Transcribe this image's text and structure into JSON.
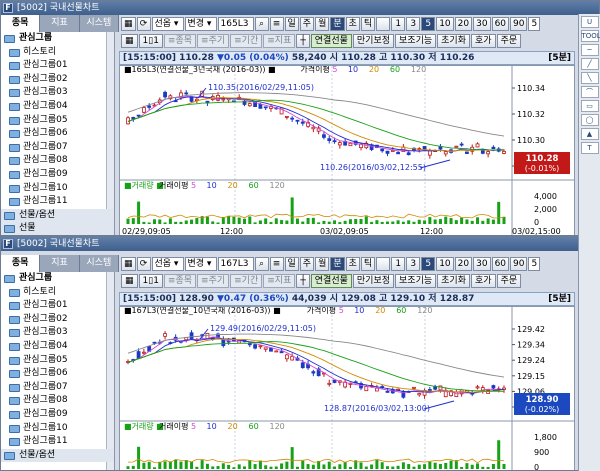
{
  "windows": [
    {
      "title": "[5002] 국내선물차트",
      "tabs": [
        "종목",
        "지표",
        "시스템"
      ],
      "tree": [
        {
          "label": "관심그룹",
          "type": "root"
        },
        {
          "label": "히스토리",
          "type": "item"
        },
        {
          "label": "관심그룹01",
          "type": "item"
        },
        {
          "label": "관심그룹02",
          "type": "item"
        },
        {
          "label": "관심그룹03",
          "type": "item"
        },
        {
          "label": "관심그룹04",
          "type": "item"
        },
        {
          "label": "관심그룹05",
          "type": "item"
        },
        {
          "label": "관심그룹06",
          "type": "item"
        },
        {
          "label": "관심그룹07",
          "type": "item"
        },
        {
          "label": "관심그룹08",
          "type": "item"
        },
        {
          "label": "관심그룹09",
          "type": "item"
        },
        {
          "label": "관심그룹10",
          "type": "item"
        },
        {
          "label": "관심그룹11",
          "type": "item"
        },
        {
          "label": "선물/옵션",
          "type": "sub"
        },
        {
          "label": "선물",
          "type": "sub"
        }
      ],
      "toolbar": {
        "market": "선옵",
        "change": "변경",
        "code": "165L3",
        "periods": [
          "일",
          "주",
          "월",
          "분",
          "초",
          "틱"
        ],
        "active_period": "분",
        "intervals": [
          "1",
          "3",
          "5",
          "10",
          "20",
          "30",
          "60",
          "90"
        ],
        "active_interval": "5",
        "count": "5"
      },
      "toolbar2": [
        "≡종목",
        "≡주기",
        "≡기간",
        "≡지표",
        "연결선물",
        "만기보정",
        "보조기능",
        "초기화",
        "호가",
        "주문"
      ],
      "info": {
        "time": "[15:15:00]",
        "price": "110.28",
        "change": "▼0.05",
        "pct": "(0.04%)",
        "volume": "58,240",
        "s_label": "시",
        "s_val": "110.28",
        "h_label": "고",
        "h_val": "110.30",
        "l_label": "저",
        "l_val": "110.26",
        "interval": "[5분]"
      },
      "price_chart": {
        "legend": "165L3(연결선물_3년국채 (2016-03))",
        "ma_title": "가격이평",
        "ma_periods": [
          "5",
          "10",
          "20",
          "60",
          "120"
        ],
        "high_note": "110.35(2016/02/29,11:05)",
        "low_note": "110.26(2016/03/02,12:55)",
        "axis": [
          "110.34",
          "110.32",
          "110.30",
          "110.28"
        ],
        "current": "110.28",
        "current_chg": "-0.01%"
      },
      "vol_chart": {
        "legend": "거래량",
        "ma_title": "거래이평",
        "ma_periods": [
          "5",
          "10",
          "20",
          "60",
          "120"
        ],
        "axis": [
          "4,000",
          "2,000",
          "0"
        ]
      },
      "time_axis": [
        "02/29,09:05",
        "12:00",
        "03/02,09:05",
        "12:00",
        "03/02,15:00"
      ]
    },
    {
      "title": "[5002] 국내선물차트",
      "tabs": [
        "종목",
        "지표",
        "시스템"
      ],
      "tree": [
        {
          "label": "관심그룹",
          "type": "root"
        },
        {
          "label": "히스토리",
          "type": "item"
        },
        {
          "label": "관심그룹01",
          "type": "item"
        },
        {
          "label": "관심그룹02",
          "type": "item"
        },
        {
          "label": "관심그룹03",
          "type": "item"
        },
        {
          "label": "관심그룹04",
          "type": "item"
        },
        {
          "label": "관심그룹05",
          "type": "item"
        },
        {
          "label": "관심그룹06",
          "type": "item"
        },
        {
          "label": "관심그룹07",
          "type": "item"
        },
        {
          "label": "관심그룹08",
          "type": "item"
        },
        {
          "label": "관심그룹09",
          "type": "item"
        },
        {
          "label": "관심그룹10",
          "type": "item"
        },
        {
          "label": "관심그룹11",
          "type": "item"
        },
        {
          "label": "선물/옵션",
          "type": "sub"
        }
      ],
      "toolbar": {
        "market": "선옵",
        "change": "변경",
        "code": "167L3",
        "periods": [
          "일",
          "주",
          "월",
          "분",
          "초",
          "틱"
        ],
        "active_period": "분",
        "intervals": [
          "1",
          "3",
          "5",
          "10",
          "20",
          "30",
          "60",
          "90"
        ],
        "active_interval": "5",
        "count": "5"
      },
      "toolbar2": [
        "≡종목",
        "≡주기",
        "≡기간",
        "≡지표",
        "연결선물",
        "만기보정",
        "보조기능",
        "초기화",
        "호가",
        "주문"
      ],
      "info": {
        "time": "[15:15:00]",
        "price": "128.90",
        "change": "▼0.47",
        "pct": "(0.36%)",
        "volume": "44,039",
        "s_label": "시",
        "s_val": "129.08",
        "h_label": "고",
        "h_val": "129.10",
        "l_label": "저",
        "l_val": "128.87",
        "interval": "[5분]"
      },
      "price_chart": {
        "legend": "167L3(연결선물_10년국채 (2016-03))",
        "ma_title": "가격이평",
        "ma_periods": [
          "5",
          "10",
          "20",
          "60",
          "120"
        ],
        "high_note": "129.49(2016/02/29,11:05)",
        "low_note": "128.87(2016/03/02,13:00)",
        "axis": [
          "129.42",
          "129.34",
          "129.24",
          "129.15",
          "129.06",
          "128.97"
        ],
        "current": "128.90",
        "current_chg": "-0.02%"
      },
      "vol_chart": {
        "legend": "거래량",
        "ma_title": "거래이평",
        "ma_periods": [
          "5",
          "10",
          "20",
          "60",
          "120"
        ],
        "axis": [
          "1,800",
          "900",
          "0"
        ]
      },
      "time_axis": []
    }
  ],
  "right_tools": [
    "U",
    "TOOL",
    "─",
    "╱",
    "╲",
    "⌒",
    "▭",
    "◯",
    "▲",
    "T"
  ],
  "colors": {
    "candle_up": "#c21818",
    "candle_down": "#1a3ac4",
    "ma5": "#d44bd4",
    "ma10": "#1f2fd0",
    "ma20": "#d08a00",
    "ma60": "#17a117",
    "ma120": "#888888"
  }
}
